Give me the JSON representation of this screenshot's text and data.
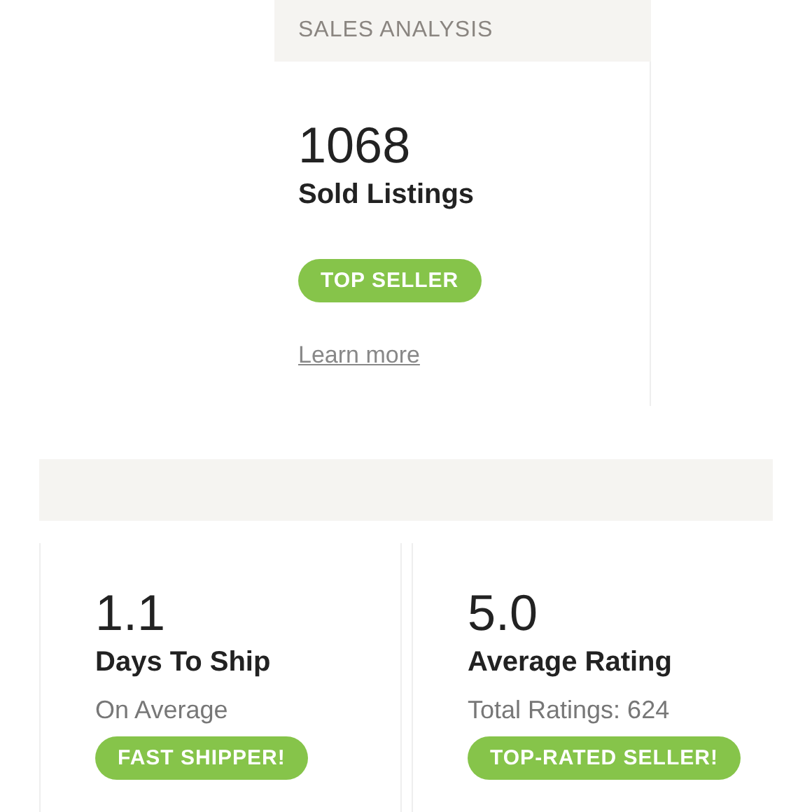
{
  "sales_analysis": {
    "title": "SALES ANALYSIS",
    "value": "1068",
    "label": "Sold Listings",
    "badge": "TOP SELLER",
    "link": "Learn more"
  },
  "stats": [
    {
      "value": "1.1",
      "label": "Days To Ship",
      "note": "On Average",
      "badge": "FAST SHIPPER!"
    },
    {
      "value": "5.0",
      "label": "Average Rating",
      "note": "Total Ratings: 624",
      "badge": "TOP-RATED SELLER!"
    }
  ]
}
